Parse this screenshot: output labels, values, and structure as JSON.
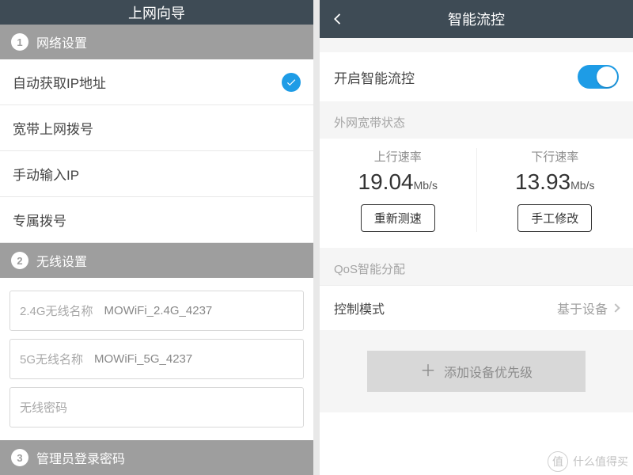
{
  "left": {
    "title": "上网向导",
    "sections": {
      "network": {
        "num": "1",
        "label": "网络设置"
      },
      "wireless": {
        "num": "2",
        "label": "无线设置"
      },
      "admin": {
        "num": "3",
        "label": "管理员登录密码"
      }
    },
    "connection_options": {
      "auto_ip": "自动获取IP地址",
      "pppoe": "宽带上网拨号",
      "manual_ip": "手动输入IP",
      "special": "专属拨号",
      "selected": "auto_ip"
    },
    "wifi": {
      "label_24g": "2.4G无线名称",
      "value_24g": "MOWiFi_2.4G_4237",
      "label_5g": "5G无线名称",
      "value_5g": "MOWiFi_5G_4237",
      "password_placeholder": "无线密码"
    }
  },
  "right": {
    "title": "智能流控",
    "enable_label": "开启智能流控",
    "enabled": true,
    "wan_label": "外网宽带状态",
    "up": {
      "title": "上行速率",
      "value": "19.04",
      "unit": "Mb/s",
      "button": "重新测速"
    },
    "down": {
      "title": "下行速率",
      "value": "13.93",
      "unit": "Mb/s",
      "button": "手工修改"
    },
    "qos_label": "QoS智能分配",
    "mode_label": "控制模式",
    "mode_value": "基于设备",
    "add_device": "添加设备优先级"
  },
  "watermark": {
    "icon": "值",
    "text": "什么值得买"
  }
}
